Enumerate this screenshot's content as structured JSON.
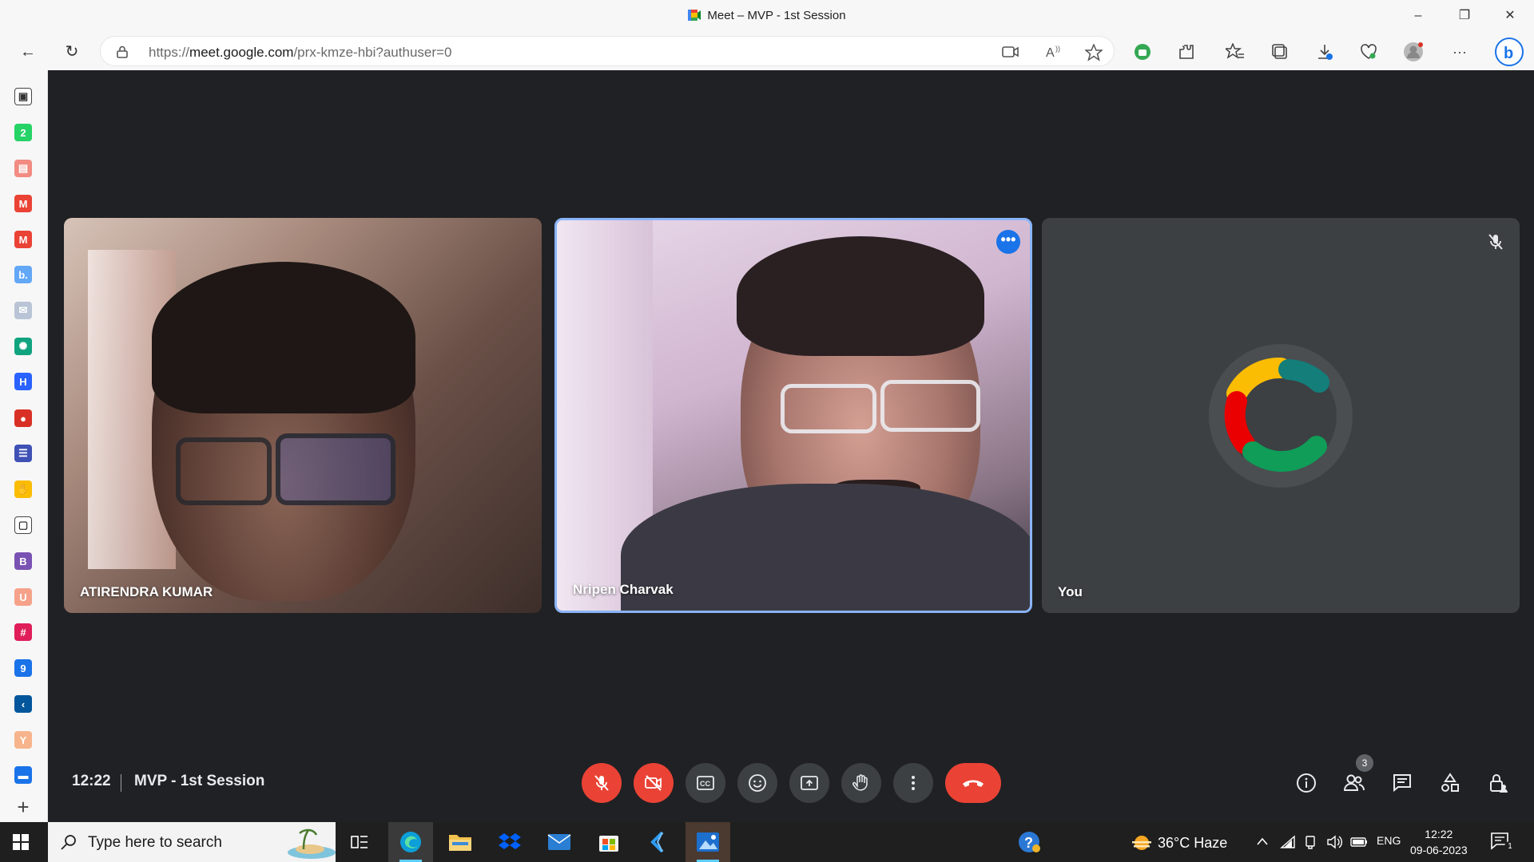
{
  "window": {
    "title": "Meet – MVP - 1st Session",
    "minimize": "–",
    "restore": "❐",
    "close": "✕"
  },
  "browser": {
    "url_prefix": "https://",
    "url_host": "meet.google.com",
    "url_path": "/prx-kmze-hbi?authuser=0",
    "back_icon": "←",
    "reload_icon": "↻",
    "more_icon": "···"
  },
  "sidebar": {
    "items": [
      {
        "icon": "tabs-icon",
        "color": "#ffffff",
        "glyph": "▣"
      },
      {
        "icon": "whatsapp-icon",
        "color": "#25d366",
        "glyph": "2"
      },
      {
        "icon": "pdf-icon",
        "color": "#f28b82",
        "glyph": "▤"
      },
      {
        "icon": "gmail-icon",
        "color": "#ea4335",
        "glyph": "M"
      },
      {
        "icon": "gmail-icon-2",
        "color": "#ea4335",
        "glyph": "M"
      },
      {
        "icon": "booking-icon",
        "color": "#63a7f7",
        "glyph": "b."
      },
      {
        "icon": "app-icon",
        "color": "#b9c4d6",
        "glyph": "✉"
      },
      {
        "icon": "chatgpt-icon",
        "color": "#10a37f",
        "glyph": "✺"
      },
      {
        "icon": "hashnode-icon",
        "color": "#2962ff",
        "glyph": "H"
      },
      {
        "icon": "record-icon",
        "color": "#d93025",
        "glyph": "●"
      },
      {
        "icon": "list-icon",
        "color": "#3f51b5",
        "glyph": "☰"
      },
      {
        "icon": "hand-icon",
        "color": "#fbbc04",
        "glyph": "✋"
      },
      {
        "icon": "document-icon",
        "color": "#ffffff",
        "glyph": "▢"
      },
      {
        "icon": "bootstrap-icon",
        "color": "#7952b3",
        "glyph": "B"
      },
      {
        "icon": "upwork-icon",
        "color": "#f6a28a",
        "glyph": "U"
      },
      {
        "icon": "slack-icon",
        "color": "#e01e5a",
        "glyph": "#"
      },
      {
        "icon": "calendar-icon",
        "color": "#1a73e8",
        "glyph": "9"
      },
      {
        "icon": "flutter-icon",
        "color": "#02569b",
        "glyph": "‹"
      },
      {
        "icon": "ycombinator-icon",
        "color": "#f7b48c",
        "glyph": "Y"
      },
      {
        "icon": "panel-icon",
        "color": "#1a73e8",
        "glyph": "▬"
      }
    ],
    "add_glyph": "+"
  },
  "participants": [
    {
      "name": "ATIRENDRA KUMAR"
    },
    {
      "name": "Nripen Charvak"
    },
    {
      "name": "You"
    }
  ],
  "tile_more_glyph": "•••",
  "meeting": {
    "time": "12:22",
    "name": "MVP - 1st Session",
    "participant_count": "3"
  },
  "taskbar": {
    "search_placeholder": "Type here to search",
    "weather": "36°C  Haze",
    "language": "ENG",
    "time": "12:22",
    "date": "09-06-2023",
    "notification_count": "1"
  },
  "colors": {
    "accent_blue": "#1a73e8",
    "danger_red": "#ea4335",
    "meet_bg": "#202124",
    "tile_bg": "#3c4043"
  }
}
